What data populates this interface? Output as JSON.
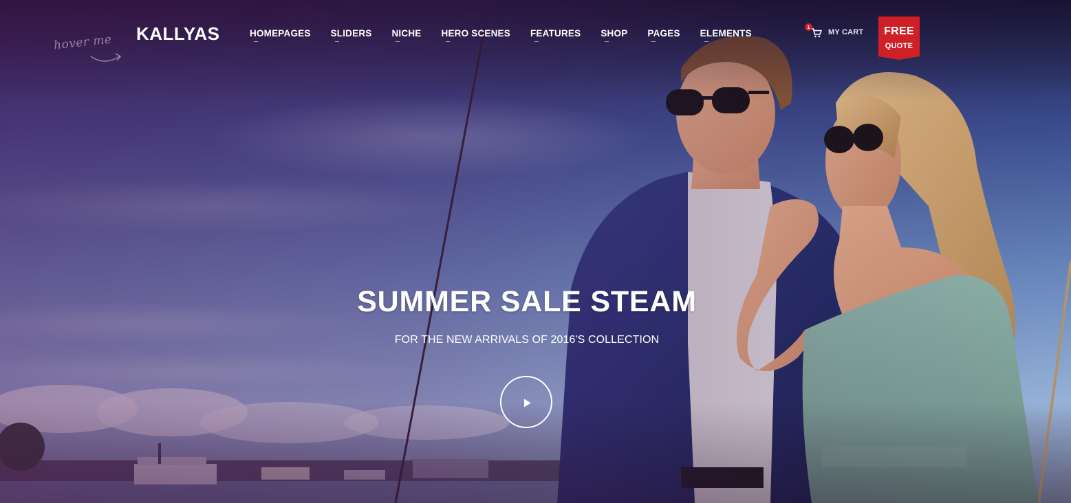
{
  "header": {
    "hover_hint": "hover me",
    "logo": "KALLYAS",
    "nav": [
      {
        "label": "HOMEPAGES"
      },
      {
        "label": "SLIDERS"
      },
      {
        "label": "NICHE"
      },
      {
        "label": "HERO SCENES"
      },
      {
        "label": "FEATURES"
      },
      {
        "label": "SHOP"
      },
      {
        "label": "PAGES"
      },
      {
        "label": "ELEMENTS"
      }
    ],
    "cart": {
      "count": "1",
      "label": "MY CART",
      "icon": "cart-icon"
    },
    "quote_button": {
      "top": "FREE",
      "bottom": "QUOTE",
      "color": "#cf2027"
    }
  },
  "hero": {
    "title": "SUMMER SALE STEAM",
    "subtitle": "FOR THE NEW ARRIVALS OF 2016'S COLLECTION",
    "play_icon": "play-icon"
  },
  "colors": {
    "overlay_tint": "#5a1c5a",
    "accent_red": "#cf2027",
    "text": "#ffffff"
  }
}
